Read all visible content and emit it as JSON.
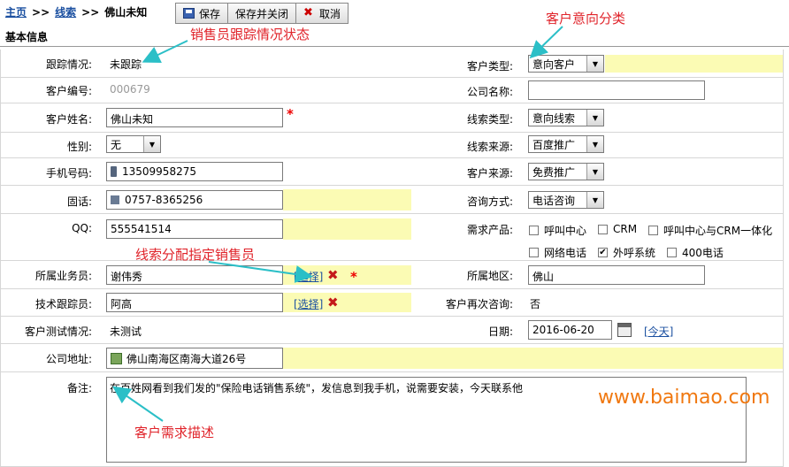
{
  "breadcrumb": {
    "home": "主页",
    "separator": ">>",
    "leads": "线索",
    "current": "佛山未知"
  },
  "toolbar": {
    "save": "保存",
    "save_close": "保存并关闭",
    "cancel": "取消"
  },
  "section_title": "基本信息",
  "fields": {
    "tracking_status": {
      "label": "跟踪情况:",
      "value": "未跟踪"
    },
    "customer_no": {
      "label": "客户编号:",
      "value": "000679"
    },
    "customer_name": {
      "label": "客户姓名:",
      "value": "佛山未知"
    },
    "gender": {
      "label": "性别:",
      "value": "无"
    },
    "mobile": {
      "label": "手机号码:",
      "value": "13509958275"
    },
    "landline": {
      "label": "固话:",
      "value": "0757-8365256"
    },
    "qq": {
      "label": "QQ:",
      "value": "555541514"
    },
    "sales_rep": {
      "label": "所属业务员:",
      "value": "谢伟秀",
      "select_link": "[选择]"
    },
    "tech_tracker": {
      "label": "技术跟踪员:",
      "value": "阿高",
      "select_link": "[选择]"
    },
    "test_status": {
      "label": "客户测试情况:",
      "value": "未测试"
    },
    "company_address": {
      "label": "公司地址:",
      "value": "佛山南海区南海大道26号"
    },
    "remarks": {
      "label": "备注:",
      "value": "在百姓网看到我们发的\"保险电话销售系统\"，发信息到我手机，说需要安装，今天联系他"
    },
    "customer_type": {
      "label": "客户类型:",
      "value": "意向客户"
    },
    "company_name": {
      "label": "公司名称:",
      "value": ""
    },
    "lead_type": {
      "label": "线索类型:",
      "value": "意向线索"
    },
    "lead_source": {
      "label": "线索来源:",
      "value": "百度推广"
    },
    "customer_source": {
      "label": "客户来源:",
      "value": "免费推广"
    },
    "inquiry_method": {
      "label": "咨询方式:",
      "value": "电话咨询"
    },
    "required_products": {
      "label": "需求产品:",
      "options": [
        {
          "label": "呼叫中心",
          "checked": false
        },
        {
          "label": "CRM",
          "checked": false
        },
        {
          "label": "呼叫中心与CRM一体化",
          "checked": false
        },
        {
          "label": "网络电话",
          "checked": false
        },
        {
          "label": "外呼系统",
          "checked": true
        },
        {
          "label": "400电话",
          "checked": false
        }
      ]
    },
    "region": {
      "label": "所属地区:",
      "value": "佛山"
    },
    "re_inquiry": {
      "label": "客户再次咨询:",
      "value": "否"
    },
    "date": {
      "label": "日期:",
      "value": "2016-06-20",
      "today_link": "[今天]"
    }
  },
  "annotations": {
    "tracking": "销售员跟踪情况状态",
    "intent": "客户意向分类",
    "assign": "线索分配指定销售员",
    "needs": "客户需求描述"
  },
  "watermark": "www.baimao.com",
  "colors": {
    "link": "#1a4fa0",
    "highlight": "#fbfbb4",
    "annotation": "#e0232a",
    "required": "#e00000",
    "watermark": "#f07810"
  }
}
